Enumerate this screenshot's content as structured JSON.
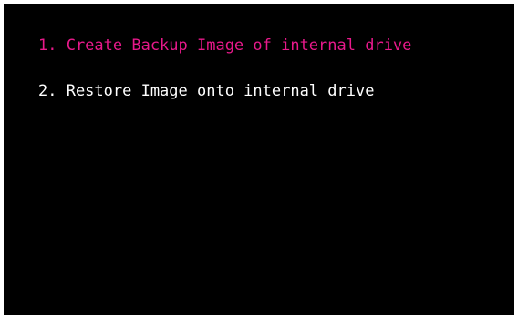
{
  "menu": {
    "items": [
      {
        "label": "1. Create Backup Image of internal drive",
        "selected": true
      },
      {
        "label": "2. Restore Image onto internal drive",
        "selected": false
      }
    ]
  },
  "colors": {
    "background": "#000000",
    "selected_text": "#e8198b",
    "normal_text": "#ffffff",
    "frame": "#ffffff"
  }
}
